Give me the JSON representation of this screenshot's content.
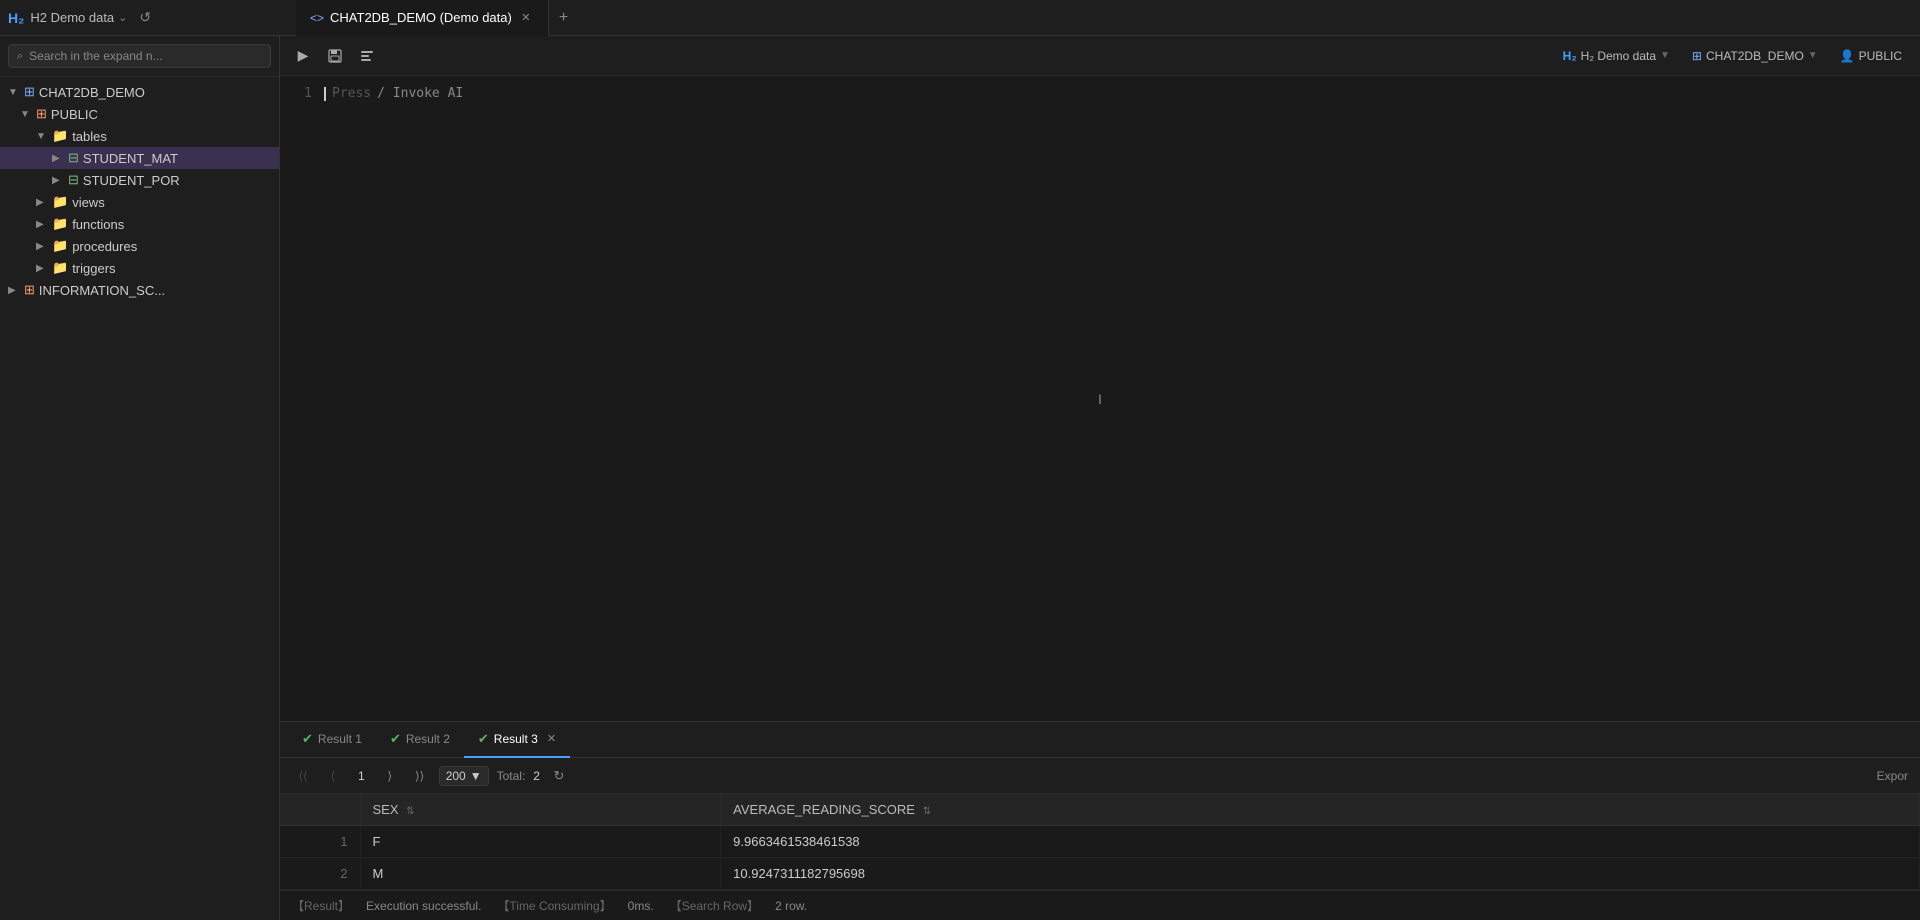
{
  "titlebar": {
    "app_name": "H2 Demo data",
    "h2_logo": "H₂",
    "chevron": "⌄",
    "refresh_icon": "↺"
  },
  "tabs": [
    {
      "label": "CHAT2DB_DEMO (Demo data)",
      "icon": "<>",
      "active": true,
      "closable": true
    }
  ],
  "tab_add": "+",
  "sidebar": {
    "search_placeholder": "Search in the expand n...",
    "tree": [
      {
        "level": 0,
        "type": "db",
        "label": "CHAT2DB_DEMO",
        "expanded": true,
        "chevron": "▼"
      },
      {
        "level": 1,
        "type": "schema",
        "label": "PUBLIC",
        "expanded": true,
        "chevron": "▼"
      },
      {
        "level": 2,
        "type": "folder",
        "label": "tables",
        "expanded": true,
        "chevron": "▼"
      },
      {
        "level": 3,
        "type": "table",
        "label": "STUDENT_MAT",
        "selected": true,
        "expanded": false,
        "chevron": "▶"
      },
      {
        "level": 3,
        "type": "table",
        "label": "STUDENT_POR",
        "selected": false,
        "expanded": false,
        "chevron": "▶"
      },
      {
        "level": 2,
        "type": "folder",
        "label": "views",
        "expanded": false,
        "chevron": "▶"
      },
      {
        "level": 2,
        "type": "folder",
        "label": "functions",
        "expanded": false,
        "chevron": "▶"
      },
      {
        "level": 2,
        "type": "folder",
        "label": "procedures",
        "expanded": false,
        "chevron": "▶"
      },
      {
        "level": 2,
        "type": "folder",
        "label": "triggers",
        "expanded": false,
        "chevron": "▶"
      },
      {
        "level": 0,
        "type": "schema",
        "label": "INFORMATION_SC...",
        "expanded": false,
        "chevron": "▶"
      }
    ]
  },
  "toolbar": {
    "run_icon": "▶",
    "save_icon": "💾",
    "format_icon": "⊡"
  },
  "header_right": {
    "db_icon": "🗄",
    "db_name": "H₂ Demo data",
    "schema_icon": "⊞",
    "schema_name": "CHAT2DB_DEMO",
    "user_icon": "👤",
    "user_name": "PUBLIC"
  },
  "editor": {
    "line_number": "1",
    "placeholder_text": "Press",
    "invoke_text": "/ Invoke AI"
  },
  "result_tabs": [
    {
      "label": "Result 1",
      "active": false,
      "closable": false,
      "icon": "✔"
    },
    {
      "label": "Result 2",
      "active": false,
      "closable": false,
      "icon": "✔"
    },
    {
      "label": "Result 3",
      "active": true,
      "closable": true,
      "icon": "✔"
    }
  ],
  "pagination": {
    "first_icon": "⟨⟨",
    "prev_icon": "⟨",
    "page_num": "1",
    "next_icon": "⟩",
    "last_icon": "⟩⟩",
    "page_size": "200",
    "page_size_chevron": "▼",
    "total_label": "Total:",
    "total_value": "2",
    "refresh_icon": "↻",
    "export_label": "Expor"
  },
  "table": {
    "row_num_header": "",
    "columns": [
      {
        "label": "SEX",
        "sortable": true
      },
      {
        "label": "AVERAGE_READING_SCORE",
        "sortable": true
      }
    ],
    "rows": [
      {
        "num": "1",
        "sex": "F",
        "score": "9.9663461538461538"
      },
      {
        "num": "2",
        "sex": "M",
        "score": "10.9247311182795698"
      }
    ]
  },
  "status_bar": {
    "result_label": "【Result】",
    "result_value": "Execution successful.",
    "time_label": "【Time Consuming】",
    "time_value": "0ms.",
    "search_label": "【Search Row】",
    "search_value": "2 row."
  }
}
